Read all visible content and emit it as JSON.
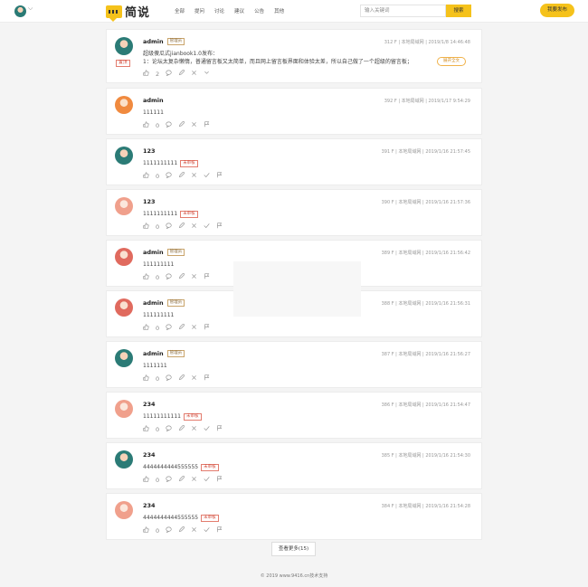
{
  "header": {
    "logo_text": "简说",
    "nav": [
      "全部",
      "提问",
      "讨论",
      "建议",
      "公告",
      "其他"
    ],
    "search_placeholder": "输入关键词",
    "search_button": "搜索",
    "publish_button": "我要发布",
    "caret": "⌵"
  },
  "posts": [
    {
      "author": "admin",
      "admin_badge": "管理员",
      "meta": "312 F  | 本地局域网 | 2019/1/8 14:46:48",
      "content_lines": [
        "超级傻瓜式jianbook1.0发布：",
        "1：论坛太复杂懒惰，普通留言板又太简单，而且网上留言板界面和体验太差，所以自己做了一个超级的留言板；"
      ],
      "pin_tag": "置顶",
      "extra_button": "展开全文",
      "likes": "2",
      "avatar": "teal"
    },
    {
      "author": "admin",
      "admin_badge": "",
      "meta": "392 F  | 本地局域网 | 2019/1/17 9:54:29",
      "content_lines": [
        "111111"
      ],
      "likes": "0",
      "avatar": "orange"
    },
    {
      "author": "123",
      "meta": "391 F  | 本地局域网 | 2019/1/16 21:57:45",
      "content_lines": [
        "1111111111"
      ],
      "review_badge": "未审核",
      "likes": "0",
      "avatar": "teal"
    },
    {
      "author": "123",
      "meta": "390 F  | 本地局域网 | 2019/1/16 21:57:36",
      "content_lines": [
        "1111111111"
      ],
      "review_badge": "未审核",
      "likes": "0",
      "avatar": "pink"
    },
    {
      "author": "admin",
      "admin_badge": "管理员",
      "meta": "389 F  | 本地局域网 | 2019/1/16 21:56:42",
      "content_lines": [
        "111111111"
      ],
      "likes": "0",
      "avatar": "red"
    },
    {
      "author": "admin",
      "admin_badge": "管理员",
      "meta": "388 F  | 本地局域网 | 2019/1/16 21:56:31",
      "content_lines": [
        "111111111"
      ],
      "likes": "0",
      "avatar": "red"
    },
    {
      "author": "admin",
      "admin_badge": "管理员",
      "meta": "387 F  | 本地局域网 | 2019/1/16 21:56:27",
      "content_lines": [
        "1111111"
      ],
      "likes": "0",
      "avatar": "teal"
    },
    {
      "author": "234",
      "meta": "386 F  | 本地局域网 | 2019/1/16 21:54:47",
      "content_lines": [
        "11111111111"
      ],
      "review_badge": "未审核",
      "likes": "0",
      "avatar": "pink"
    },
    {
      "author": "234",
      "meta": "385 F  | 本地局域网 | 2019/1/16 21:54:30",
      "content_lines": [
        "4444444444555555"
      ],
      "review_badge": "未审核",
      "likes": "0",
      "avatar": "teal"
    },
    {
      "author": "234",
      "meta": "384 F  | 本地局域网 | 2019/1/16 21:54:28",
      "content_lines": [
        "4444444444555555"
      ],
      "review_badge": "未审核",
      "likes": "0",
      "avatar": "pink"
    }
  ],
  "more_button": "查看更多(15)",
  "footer": "© 2019 www.9416.cn技术支持"
}
